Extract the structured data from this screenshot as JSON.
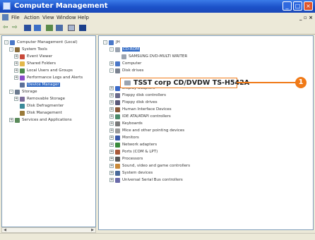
{
  "window": {
    "title": "Computer Management"
  },
  "menu": {
    "items": [
      "File",
      "Action",
      "View",
      "Window",
      "Help"
    ]
  },
  "left_tree": [
    {
      "label": "Computer Management (Local)",
      "level": 0,
      "expander": "-",
      "icon": "computer-icon"
    },
    {
      "label": "System Tools",
      "level": 1,
      "expander": "-",
      "icon": "tools-icon"
    },
    {
      "label": "Event Viewer",
      "level": 2,
      "expander": "+",
      "icon": "event-viewer-icon"
    },
    {
      "label": "Shared Folders",
      "level": 2,
      "expander": "+",
      "icon": "folder-icon"
    },
    {
      "label": "Local Users and Groups",
      "level": 2,
      "expander": "+",
      "icon": "users-icon"
    },
    {
      "label": "Performance Logs and Alerts",
      "level": 2,
      "expander": "+",
      "icon": "performance-icon"
    },
    {
      "label": "Device Manager",
      "level": 2,
      "expander": "",
      "icon": "device-manager-icon",
      "selected": true
    },
    {
      "label": "Storage",
      "level": 1,
      "expander": "-",
      "icon": "storage-icon"
    },
    {
      "label": "Removable Storage",
      "level": 2,
      "expander": "+",
      "icon": "removable-storage-icon"
    },
    {
      "label": "Disk Defragmenter",
      "level": 2,
      "expander": "",
      "icon": "defrag-icon"
    },
    {
      "label": "Disk Management",
      "level": 2,
      "expander": "",
      "icon": "disk-management-icon"
    },
    {
      "label": "Services and Applications",
      "level": 1,
      "expander": "+",
      "icon": "services-icon"
    }
  ],
  "right_tree": [
    {
      "label": "JH",
      "level": 0,
      "expander": "-",
      "icon": "computer-icon"
    },
    {
      "label": "CD-ROM",
      "level": 1,
      "expander": "-",
      "icon": "cdrom-icon",
      "selected": true
    },
    {
      "label": "SAMSUNG DVD-MULTI WRITER",
      "level": 2,
      "expander": "",
      "icon": "cdrom-icon"
    },
    {
      "label": "Computer",
      "level": 1,
      "expander": "+",
      "icon": "computer-icon"
    },
    {
      "label": "Disk drives",
      "level": 1,
      "expander": "-",
      "icon": "disk-icon"
    },
    {
      "label": "Display adapters",
      "level": 1,
      "expander": "+",
      "icon": "display-icon"
    },
    {
      "label": "Floppy disk controllers",
      "level": 1,
      "expander": "+",
      "icon": "floppy-controller-icon"
    },
    {
      "label": "Floppy disk drives",
      "level": 1,
      "expander": "+",
      "icon": "floppy-icon"
    },
    {
      "label": "Human Interface Devices",
      "level": 1,
      "expander": "+",
      "icon": "hid-icon"
    },
    {
      "label": "IDE ATA/ATAPI controllers",
      "level": 1,
      "expander": "+",
      "icon": "ide-icon"
    },
    {
      "label": "Keyboards",
      "level": 1,
      "expander": "+",
      "icon": "keyboard-icon"
    },
    {
      "label": "Mice and other pointing devices",
      "level": 1,
      "expander": "+",
      "icon": "mouse-icon"
    },
    {
      "label": "Monitors",
      "level": 1,
      "expander": "+",
      "icon": "monitor-icon"
    },
    {
      "label": "Network adapters",
      "level": 1,
      "expander": "+",
      "icon": "network-icon"
    },
    {
      "label": "Ports (COM & LPT)",
      "level": 1,
      "expander": "+",
      "icon": "port-icon"
    },
    {
      "label": "Processors",
      "level": 1,
      "expander": "+",
      "icon": "processor-icon"
    },
    {
      "label": "Sound, video and game controllers",
      "level": 1,
      "expander": "+",
      "icon": "sound-icon"
    },
    {
      "label": "System devices",
      "level": 1,
      "expander": "+",
      "icon": "system-icon"
    },
    {
      "label": "Universal Serial Bus controllers",
      "level": 1,
      "expander": "+",
      "icon": "usb-icon"
    }
  ],
  "highlighted_device": {
    "label": "TSST corp CD/DVDW TS-H542A",
    "icon": "cdrom-icon"
  },
  "callout": {
    "number": "1"
  },
  "colors": {
    "callout": "#f07a18",
    "title_bar": "#1c52c9",
    "selection": "#316ac5"
  }
}
